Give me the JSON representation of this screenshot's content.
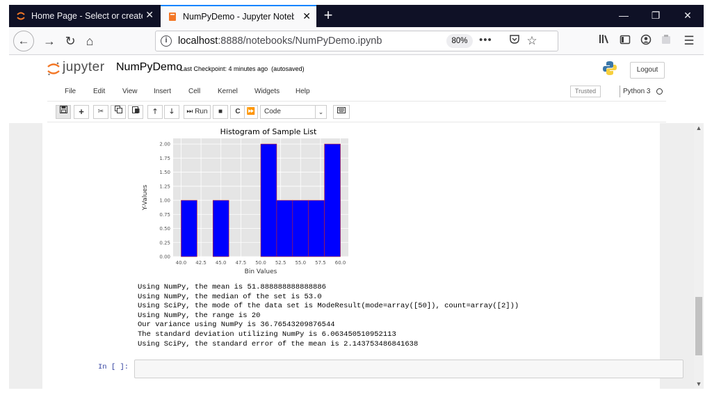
{
  "browser": {
    "tabs": [
      {
        "title": "Home Page - Select or create a notebook",
        "active": false
      },
      {
        "title": "NumPyDemo - Jupyter Notebook",
        "active": true
      }
    ],
    "new_tab": "+",
    "window_controls": {
      "minimize": "—",
      "restore": "❐",
      "close": "✕"
    },
    "url": {
      "host": "localhost",
      "rest": ":8888/notebooks/NumPyDemo.ipynb"
    },
    "zoom": "80%",
    "page_actions": "•••",
    "icons": [
      "back-icon",
      "forward-icon",
      "reload-icon",
      "home-icon",
      "info-icon",
      "pocket-icon",
      "bookmark-star-icon",
      "library-icon",
      "sidebar-icon",
      "account-icon",
      "extension-icon",
      "menu-icon"
    ]
  },
  "jupyter": {
    "logo_text": "jupyter",
    "notebook_name": "NumPyDemo",
    "checkpoint": "Last Checkpoint: 4 minutes ago",
    "autosave": "(autosaved)",
    "logout": "Logout",
    "menu": [
      "File",
      "Edit",
      "View",
      "Insert",
      "Cell",
      "Kernel",
      "Widgets",
      "Help"
    ],
    "trusted": "Trusted",
    "kernel": "Python 3",
    "toolbar": {
      "run_label": "Run",
      "cell_type": "Code"
    },
    "output_lines": [
      "Using NumPy, the mean is 51.888888888888886",
      "Using NumPy, the median of the set is 53.0",
      "Using SciPy, the mode of the data set is ModeResult(mode=array([50]), count=array([2]))",
      "Using NumPy, the range is 20",
      "Our variance using NumPy is 36.76543209876544",
      "The standard deviation utilizing NumPy is 6.063450510952113",
      "Using SciPy, the standard error of the mean is 2.143753486841638"
    ],
    "in_prompt": "In [ ]:"
  },
  "chart_data": {
    "type": "bar",
    "title": "Histogram of Sample List",
    "xlabel": "Bin Values",
    "ylabel": "Y-Values",
    "bins": [
      {
        "x0": 40,
        "x1": 42,
        "count": 1
      },
      {
        "x0": 42,
        "x1": 44,
        "count": 0
      },
      {
        "x0": 44,
        "x1": 46,
        "count": 1
      },
      {
        "x0": 46,
        "x1": 48,
        "count": 0
      },
      {
        "x0": 48,
        "x1": 50,
        "count": 0
      },
      {
        "x0": 50,
        "x1": 52,
        "count": 2
      },
      {
        "x0": 52,
        "x1": 54,
        "count": 1
      },
      {
        "x0": 54,
        "x1": 56,
        "count": 1
      },
      {
        "x0": 56,
        "x1": 58,
        "count": 1
      },
      {
        "x0": 58,
        "x1": 60,
        "count": 2
      }
    ],
    "xticks": [
      "40.0",
      "42.5",
      "45.0",
      "47.5",
      "50.0",
      "52.5",
      "55.0",
      "57.5",
      "60.0"
    ],
    "xtick_values": [
      40,
      42.5,
      45,
      47.5,
      50,
      52.5,
      55,
      57.5,
      60
    ],
    "yticks": [
      "0.00",
      "0.25",
      "0.50",
      "0.75",
      "1.00",
      "1.25",
      "1.50",
      "1.75",
      "2.00"
    ],
    "ytick_values": [
      0,
      0.25,
      0.5,
      0.75,
      1.0,
      1.25,
      1.5,
      1.75,
      2.0
    ],
    "xlim": [
      39.0,
      61.0
    ],
    "ylim": [
      0,
      2.1
    ],
    "grid": true,
    "colors": {
      "bar_fill": "#0000ff",
      "bar_edge": "#cc2222",
      "plot_bg": "#e5e5e5",
      "grid": "#ffffff"
    }
  }
}
